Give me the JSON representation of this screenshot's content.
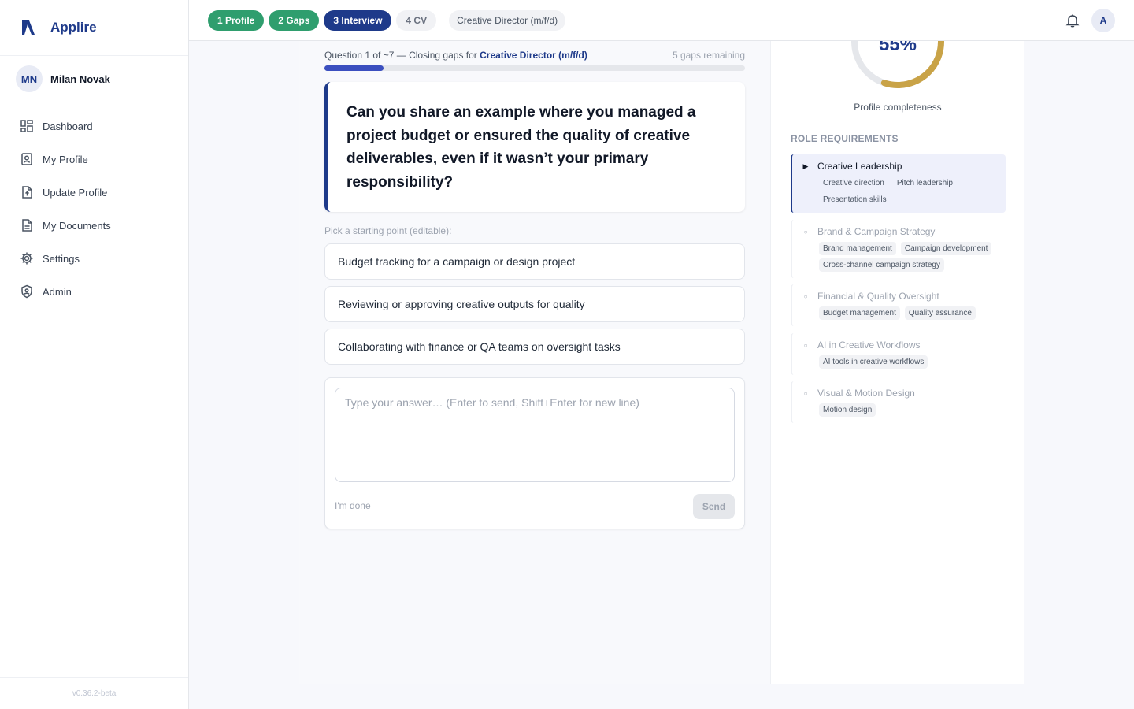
{
  "app": {
    "name": "Applire",
    "version": "v0.36.2-beta"
  },
  "user": {
    "initials": "MN",
    "name": "Milan Novak"
  },
  "nav": [
    {
      "label": "Dashboard",
      "icon": "dashboard-icon"
    },
    {
      "label": "My Profile",
      "icon": "profile-icon"
    },
    {
      "label": "Update Profile",
      "icon": "upload-file-icon"
    },
    {
      "label": "My Documents",
      "icon": "document-icon"
    },
    {
      "label": "Settings",
      "icon": "gear-icon"
    },
    {
      "label": "Admin",
      "icon": "shield-user-icon"
    }
  ],
  "steps": [
    {
      "label": "1 Profile",
      "state": "done"
    },
    {
      "label": "2 Gaps",
      "state": "done"
    },
    {
      "label": "3 Interview",
      "state": "active"
    },
    {
      "label": "4 CV",
      "state": "todo"
    }
  ],
  "topbar": {
    "role": "Creative Director (m/f/d)",
    "avatar_initial": "A"
  },
  "colors": {
    "brand": "#1e3a8a",
    "done": "#2f9e6e",
    "progress": "#3b4fbf",
    "ring": "#c9a347"
  },
  "interview": {
    "progress_prefix": "Question 1 of ~7 — Closing gaps for ",
    "role_link": "Creative Director (m/f/d)",
    "gaps_remaining": "5 gaps remaining",
    "progress_fraction": 0.14,
    "question": "Can you share an example where you managed a project budget or ensured the quality of creative deliverables, even if it wasn’t your primary responsibility?",
    "suggest_label": "Pick a starting point (editable):",
    "suggestions": [
      "Budget tracking for a campaign or design project",
      "Reviewing or approving creative outputs for quality",
      "Collaborating with finance or QA teams on oversight tasks"
    ],
    "answer_placeholder": "Type your answer… (Enter to send, Shift+Enter for new line)",
    "done_label": "I'm done",
    "send_label": "Send"
  },
  "profile": {
    "completeness_display": "55%",
    "completeness_fraction": 0.55,
    "completeness_label": "Profile completeness"
  },
  "requirements": {
    "title": "ROLE REQUIREMENTS",
    "items": [
      {
        "name": "Creative Leadership",
        "active": true,
        "tags": [
          "Creative direction",
          "Pitch leadership",
          "Presentation skills"
        ]
      },
      {
        "name": "Brand & Campaign Strategy",
        "active": false,
        "tags": [
          "Brand management",
          "Campaign development",
          "Cross-channel campaign strategy"
        ]
      },
      {
        "name": "Financial & Quality Oversight",
        "active": false,
        "tags": [
          "Budget management",
          "Quality assurance"
        ]
      },
      {
        "name": "AI in Creative Workflows",
        "active": false,
        "tags": [
          "AI tools in creative workflows"
        ]
      },
      {
        "name": "Visual & Motion Design",
        "active": false,
        "tags": [
          "Motion design"
        ]
      }
    ]
  }
}
